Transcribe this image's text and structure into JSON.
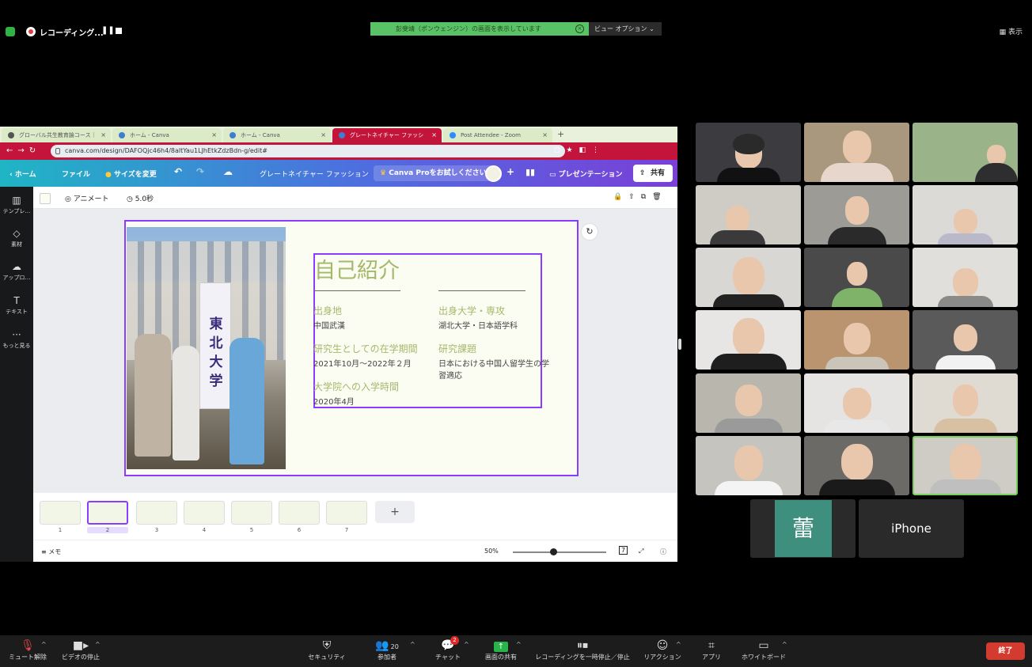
{
  "topbar": {
    "recording_label": "レコーディング...",
    "share_banner": "彭斐靖（ポンウェンジン）の画面を表示しています",
    "view_options": "ビュー オプション ⌄",
    "display_label": "表示"
  },
  "browser": {
    "tabs": [
      {
        "title": "グローバル共生教育論コース｜"
      },
      {
        "title": "ホーム - Canva"
      },
      {
        "title": "ホーム - Canva"
      },
      {
        "title": "グレートネイチャー ファッシ"
      },
      {
        "title": "Post Attendee - Zoom"
      }
    ],
    "url": "canva.com/design/DAFOQjc46h4/8altYau1LJhEtkZdzBdn-g/edit#"
  },
  "canva": {
    "home": "ホーム",
    "file": "ファイル",
    "resize": "サイズを変更",
    "doc_title": "グレートネイチャー ファッション",
    "pro_trial": "Canva Proをお試しください",
    "present": "プレゼンテーション",
    "share": "共有",
    "rail": [
      "テンプレ…",
      "素材",
      "アップロ…",
      "テキスト",
      "もっと見る"
    ],
    "animate": "アニメート",
    "duration": "5.0秒",
    "notes": "メモ",
    "zoom": "50%",
    "page_count": "7",
    "thumb_numbers": [
      "1",
      "2",
      "3",
      "4",
      "5",
      "6",
      "7"
    ]
  },
  "slide": {
    "banner_text": "東北大学",
    "title": "自己紹介",
    "hometown_head": "出身地",
    "hometown": "中国武漢",
    "univ_head": "出身大学・専攻",
    "univ": "湖北大学・日本語学科",
    "research_period_head": "研究生としての在学期間",
    "research_period": "2021年10月〜2022年２月",
    "topic_head": "研究課題",
    "topic": "日本における中国人留学生の学習適応",
    "grad_head": "大学院への入学時間",
    "grad": "2020年4月"
  },
  "gallery": {
    "name_tiles": [
      "蕾",
      "iPhone"
    ]
  },
  "controls": {
    "mute": "ミュート解除",
    "video": "ビデオの停止",
    "security": "セキュリティ",
    "participants": "参加者",
    "participant_count": "20",
    "chat": "チャット",
    "chat_badge": "2",
    "share": "画面の共有",
    "recording": "レコーディングを一時停止／停止",
    "reaction": "リアクション",
    "apps": "アプリ",
    "whiteboard": "ホワイトボード",
    "end": "終了"
  },
  "colors": {
    "canva_accent": "#8b3dff",
    "title_green": "#a4b86a",
    "browser_red": "#c3153b",
    "share_green": "#5ac266",
    "end_red": "#d43b30"
  }
}
